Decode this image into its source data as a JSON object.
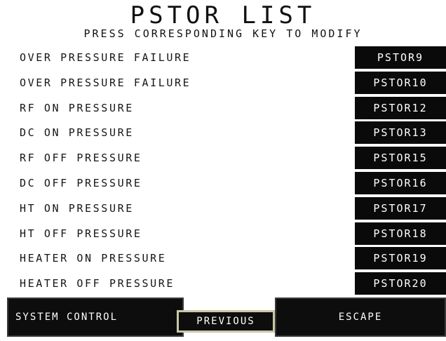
{
  "header": {
    "title": "PSTOR LIST",
    "subtitle": "PRESS CORRESPONDING KEY TO MODIFY"
  },
  "rows": [
    {
      "label": "OVER PRESSURE FAILURE",
      "key": "PSTOR9"
    },
    {
      "label": "OVER PRESSURE FAILURE",
      "key": "PSTOR10"
    },
    {
      "label": "RF ON PRESSURE",
      "key": "PSTOR12"
    },
    {
      "label": "DC ON PRESSURE",
      "key": "PSTOR13"
    },
    {
      "label": "RF OFF PRESSURE",
      "key": "PSTOR15"
    },
    {
      "label": "DC OFF PRESSURE",
      "key": "PSTOR16"
    },
    {
      "label": "HT ON PRESSURE",
      "key": "PSTOR17"
    },
    {
      "label": "HT OFF PRESSURE",
      "key": "PSTOR18"
    },
    {
      "label": "HEATER ON PRESSURE",
      "key": "PSTOR19"
    },
    {
      "label": "HEATER OFF PRESSURE",
      "key": "PSTOR20"
    }
  ],
  "footer": {
    "system_control_label": "SYSTEM CONTROL",
    "previous_label": "PREVIOUS",
    "escape_label": "ESCAPE"
  },
  "colors": {
    "background": "#ffffff",
    "key_background": "#0a0a0a",
    "key_text": "#ffffff",
    "label_text": "#151515",
    "previous_border": "#c9c7a6"
  }
}
